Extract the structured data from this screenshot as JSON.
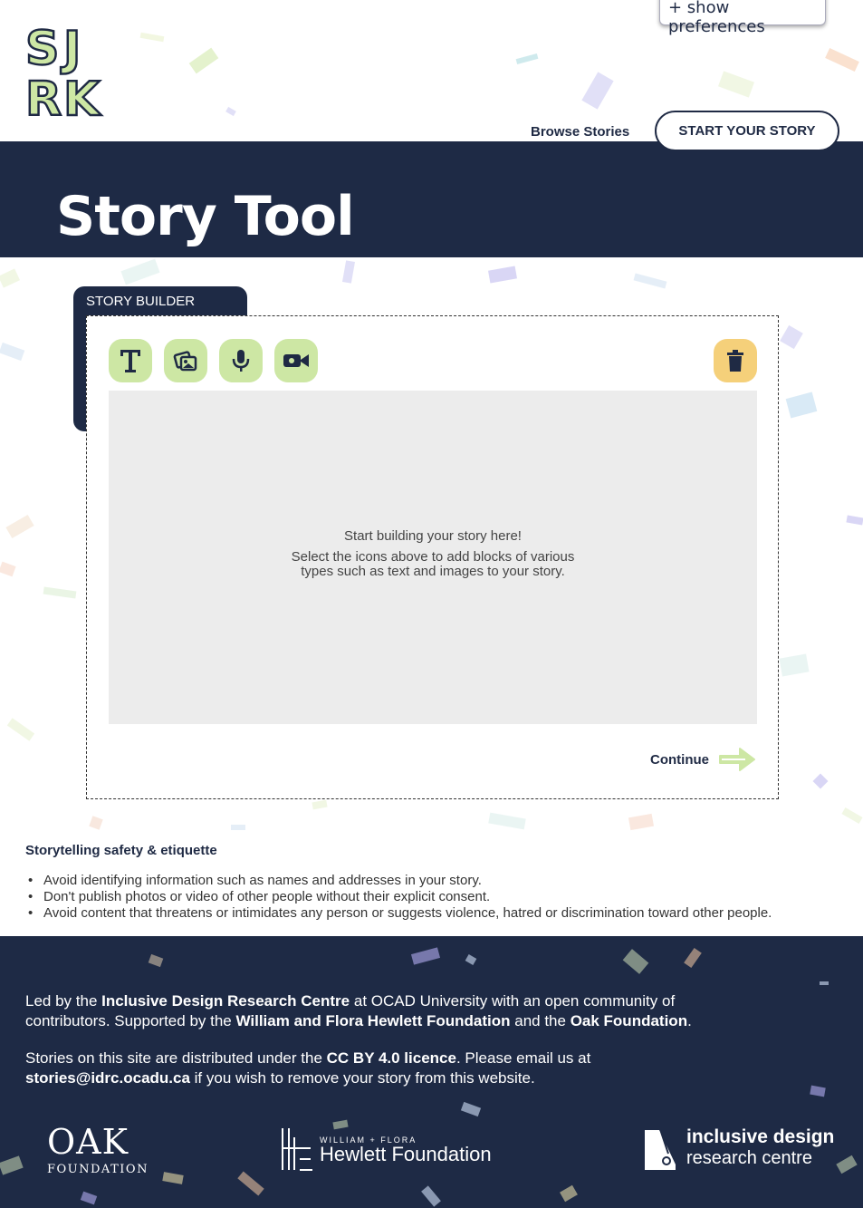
{
  "preferences": {
    "toggle_label": "+ show preferences"
  },
  "logo": {
    "letters": [
      "S",
      "J",
      "R",
      "K"
    ]
  },
  "nav": {
    "browse_label": "Browse Stories",
    "start_label": "START YOUR STORY"
  },
  "hero": {
    "title": "Story Tool"
  },
  "builder": {
    "tab_label": "STORY BUILDER",
    "tools": [
      {
        "icon": "text-icon"
      },
      {
        "icon": "image-icon"
      },
      {
        "icon": "microphone-icon"
      },
      {
        "icon": "video-icon"
      }
    ],
    "delete_icon": "trash-icon",
    "empty_title": "Start building your story here!",
    "empty_desc": "Select the icons above to add blocks of various types such as text and images to your story.",
    "continue_label": "Continue"
  },
  "etiquette": {
    "title": "Storytelling safety & etiquette",
    "items": [
      "Avoid identifying information such as names and addresses in your story.",
      "Don't publish photos or video of other people without their explicit consent.",
      "Avoid content that threatens or intimidates any person or suggests violence, hatred or discrimination toward other people."
    ]
  },
  "footer": {
    "p1_a": "Led by the ",
    "p1_b": "Inclusive Design Research Centre",
    "p1_c": " at OCAD University with an open community of contributors. Supported by the ",
    "p1_d": "William and Flora Hewlett Foundation",
    "p1_e": " and the ",
    "p1_f": "Oak Foundation",
    "p1_g": ".",
    "p2_a": "Stories on this site are distributed under the ",
    "p2_b": "CC BY 4.0 licence",
    "p2_c": ". Please email us at ",
    "p2_d": "stories@idrc.ocadu.ca",
    "p2_e": " if you wish to remove your story from this website.",
    "oak": {
      "big": "OAK",
      "small": "FOUNDATION"
    },
    "hewlett": {
      "small": "WILLIAM + FLORA",
      "big": "Hewlett Foundation"
    },
    "idrc": {
      "line1": "inclusive design",
      "line2": "research centre"
    }
  },
  "colors": {
    "navy": "#1e2a45",
    "green": "#cde7a4",
    "yellow": "#f5d07a"
  }
}
